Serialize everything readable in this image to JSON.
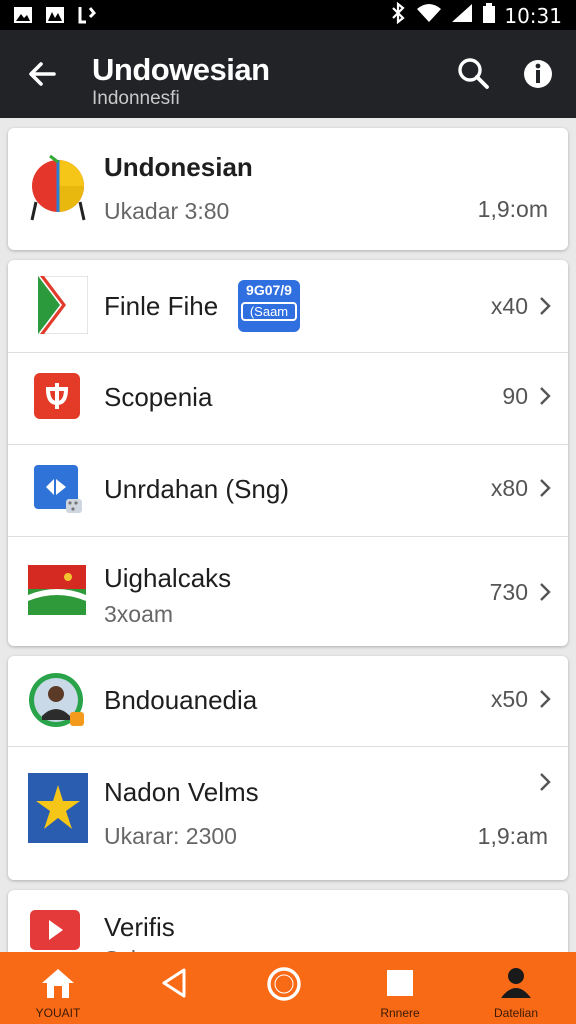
{
  "status_bar": {
    "time": "10:31"
  },
  "app_bar": {
    "title": "Undowesian",
    "subtitle": "Indonnesfi"
  },
  "top_card": {
    "title": "Undonesian",
    "subtitle": "Ukadar 3:80",
    "value": "1,9:om"
  },
  "card2": [
    {
      "title": "Finle Fihe",
      "badge_top": "9G07/9",
      "badge_bottom": "(Saam",
      "value": "x40"
    },
    {
      "title": "Scopenia",
      "value": "90"
    },
    {
      "title": "Unrdahan (Sng)",
      "value": "x80"
    },
    {
      "title": "Uighalcaks",
      "subtitle": "3xoam",
      "value": "730"
    }
  ],
  "card3": [
    {
      "title": "Bndouanedia",
      "value": "x50"
    },
    {
      "title": "Nadon Velms",
      "subtitle": "Ukarar: 2300",
      "value": "1,9:am"
    }
  ],
  "partial_card": {
    "title": "Verifis",
    "subtitle": "Sybun"
  },
  "bottom_nav": {
    "home_label": "YOUAIT",
    "square_label": "Rnnere",
    "profile_label": "Datelian"
  },
  "colors": {
    "app_bar": "#212327",
    "bottom_nav": "#f96a17",
    "badge": "#2f6fe0"
  }
}
